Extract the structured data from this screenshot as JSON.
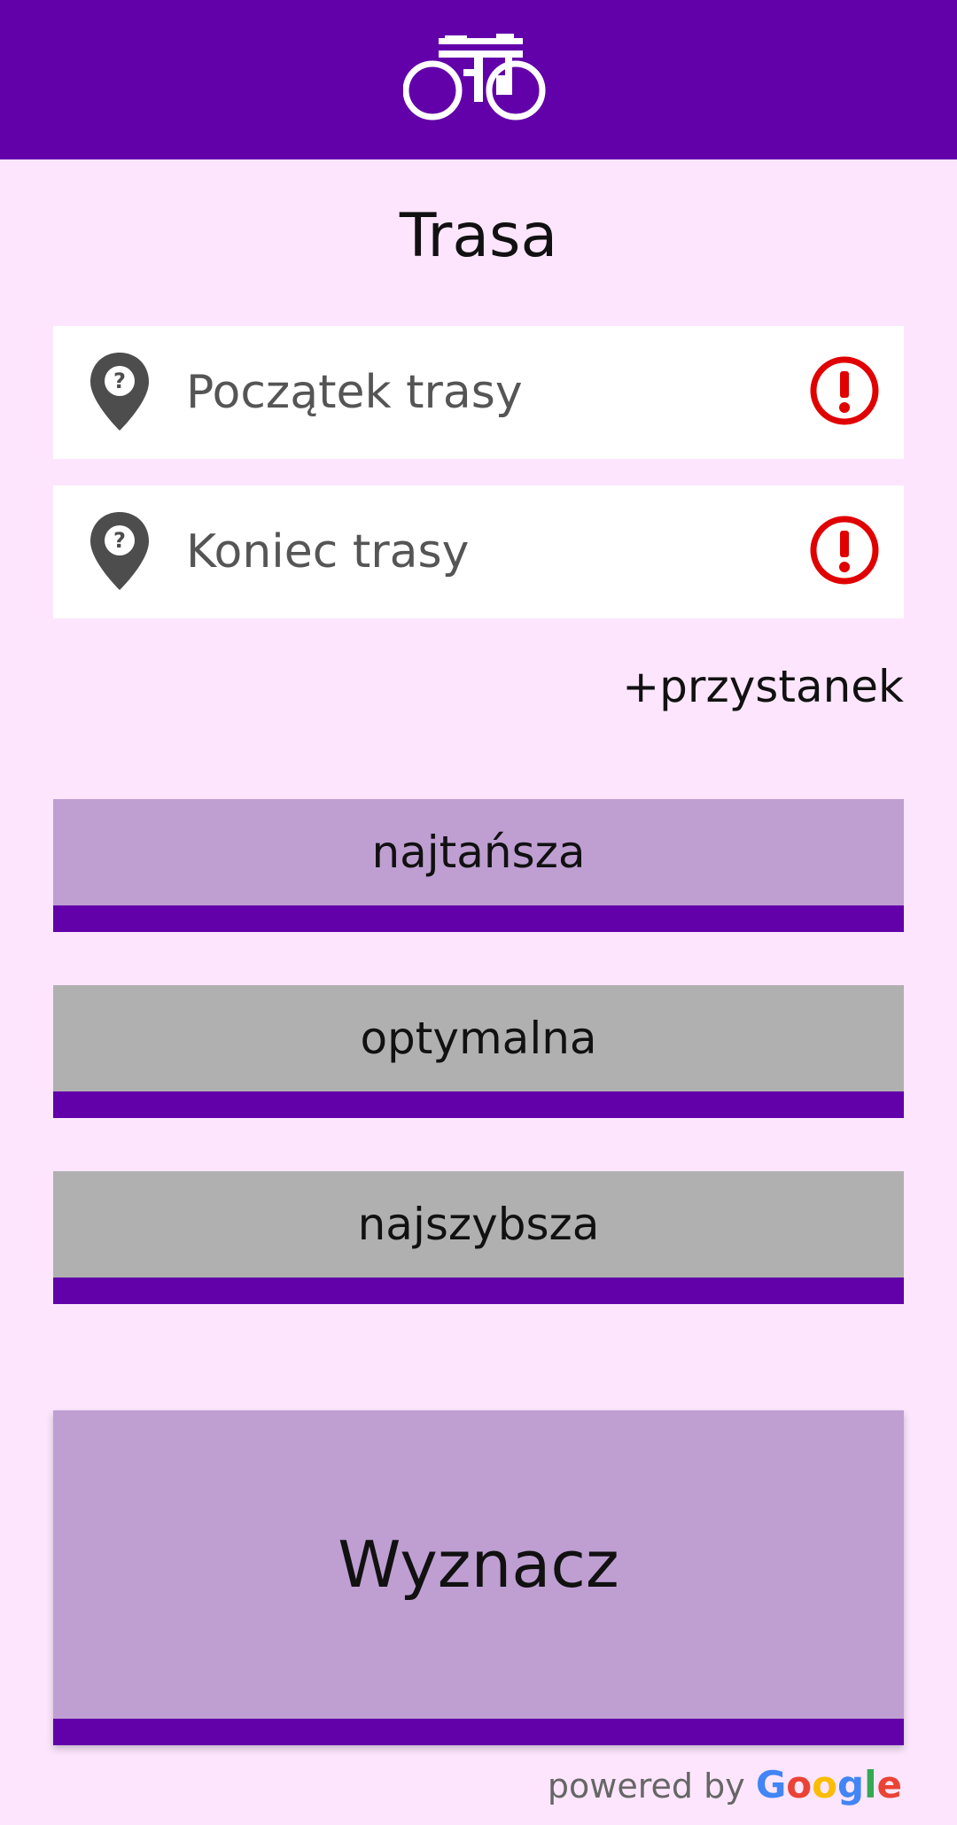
{
  "header": {
    "icon": "bicycle-icon",
    "background": "#6200aa"
  },
  "title": "Trasa",
  "fields": [
    {
      "placeholder": "Początek trasy",
      "icon": "map-pin-question-icon",
      "status_icon": "error-exclamation-icon"
    },
    {
      "placeholder": "Koniec trasy",
      "icon": "map-pin-question-icon",
      "status_icon": "error-exclamation-icon"
    }
  ],
  "add_stop_label": "+przystanek",
  "route_options": [
    {
      "label": "najtańsza",
      "selected": true
    },
    {
      "label": "optymalna",
      "selected": false
    },
    {
      "label": "najszybsza",
      "selected": false
    }
  ],
  "compute_button_label": "Wyznacz",
  "powered_by": {
    "prefix": "powered by",
    "brand_letters": [
      "G",
      "o",
      "o",
      "g",
      "l",
      "e"
    ]
  },
  "colors": {
    "accent": "#6200aa",
    "background": "#fde6fd",
    "selected_option": "#bf9fd2",
    "unselected_option": "#b0b0b0",
    "error": "#e00000"
  }
}
